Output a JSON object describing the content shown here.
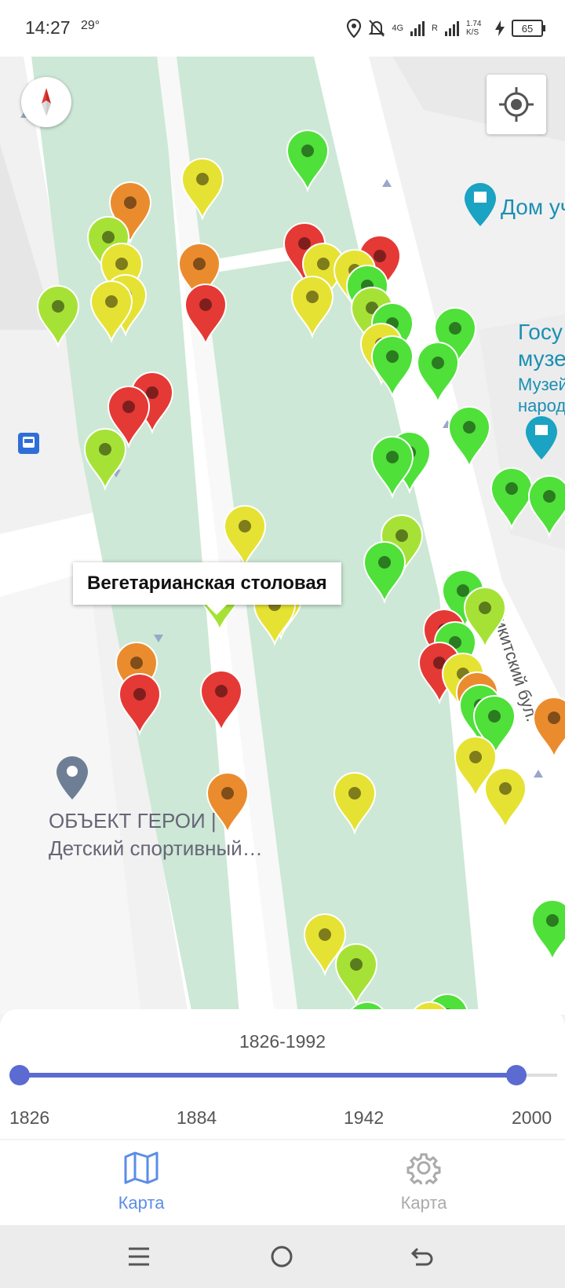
{
  "status": {
    "time": "14:27",
    "temperature": "29°",
    "network": "4G",
    "roaming": "R",
    "speed": "1.74 K/S",
    "battery": "65"
  },
  "map": {
    "tooltip_label": "Вегетарианская столовая",
    "poi_museum_name": "Дом уч",
    "poi_gov_line1": "Госу",
    "poi_gov_line2": "музе",
    "poi_gov_line3": "Музей",
    "poi_gov_line4": "народ",
    "poi_hero_line1": "ОБЪЕКТ ГЕРОИ |",
    "poi_hero_line2": "Детский спортивный…",
    "street_label": "Никитский бул.",
    "marker_colors": {
      "red": "#e53935",
      "orange": "#ea8c2e",
      "yellow": "#e6e233",
      "lime": "#a6e236",
      "green": "#4fe03a"
    }
  },
  "timeline": {
    "range_label": "1826-1992",
    "min": 1826,
    "max": 2000,
    "selected_from": 1826,
    "selected_to": 1992,
    "ticks": [
      "1826",
      "1884",
      "1942",
      "2000"
    ]
  },
  "bottom_nav": {
    "items": [
      {
        "label": "Карта",
        "icon": "map-icon",
        "active": true
      },
      {
        "label": "Карта",
        "icon": "gear-icon",
        "active": false
      }
    ],
    "active_color": "#5b8de8",
    "inactive_color": "#aaaaaa"
  },
  "system_nav": {
    "icons": [
      "menu-icon",
      "home-icon",
      "back-icon"
    ]
  }
}
